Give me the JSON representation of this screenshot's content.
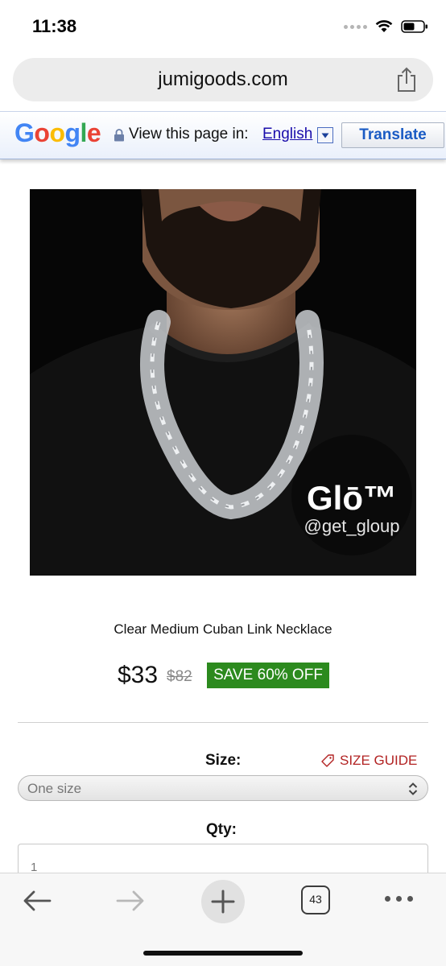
{
  "status_bar": {
    "time": "11:38",
    "signal_icon": "signal-dots-icon",
    "wifi_icon": "wifi-icon",
    "battery_icon": "battery-icon"
  },
  "browser": {
    "url": "jumigoods.com",
    "share_icon": "share-icon"
  },
  "translate_bar": {
    "logo": "Google",
    "lock_icon": "lock-icon",
    "view_label": "View this page in:",
    "language": "English",
    "dropdown_icon": "triangle-down-icon",
    "translate_label": "Translate",
    "logo_colors": [
      "#4285F4",
      "#EA4335",
      "#FBBC05",
      "#4285F4",
      "#34A853",
      "#EA4335"
    ]
  },
  "product": {
    "image_badge_name": "Glō™",
    "image_badge_handle": "@get_gloup",
    "title": "Clear Medium Cuban Link Necklace",
    "price": "$33",
    "old_price": "$82",
    "save_badge": "SAVE 60% OFF",
    "save_badge_color": "#2c8a1e"
  },
  "options": {
    "size_label": "Size:",
    "size_guide_label": "SIZE GUIDE",
    "size_guide_icon": "tag-icon",
    "size_value": "One size",
    "qty_label": "Qty:",
    "qty_value": "1"
  },
  "toolbar": {
    "back_icon": "arrow-left-icon",
    "forward_icon": "arrow-right-icon",
    "new_tab_icon": "plus-icon",
    "tabs_count": "43",
    "more_icon": "more-dots-icon"
  }
}
